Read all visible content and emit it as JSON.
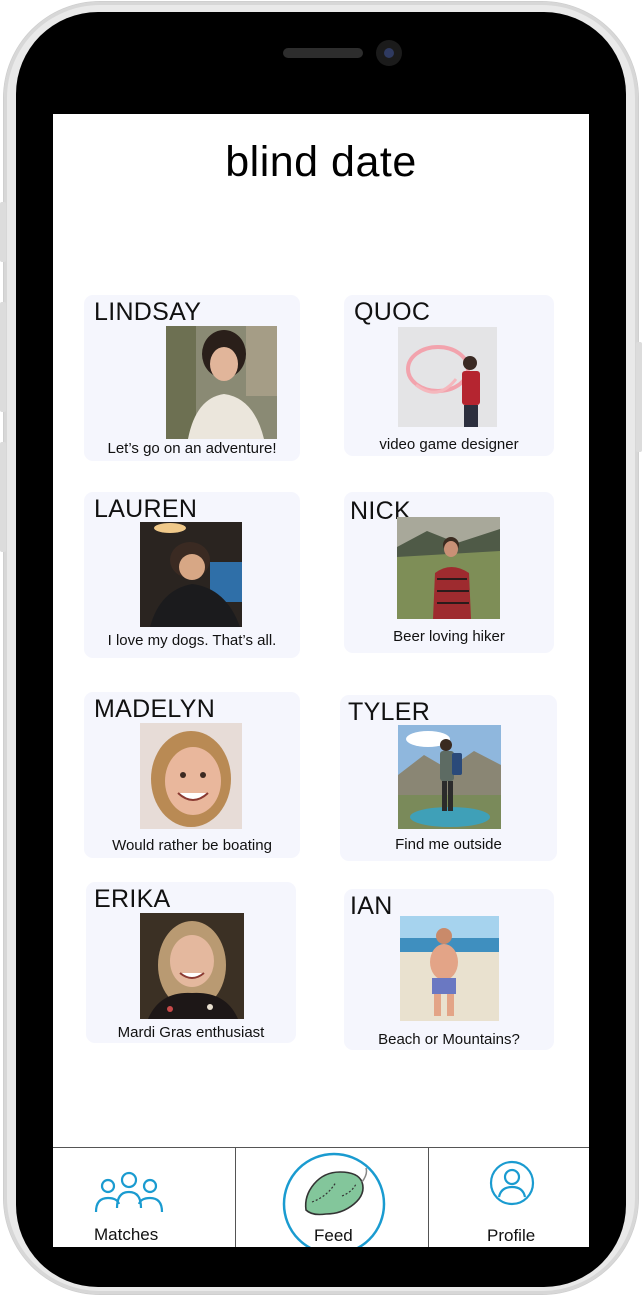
{
  "app": {
    "title": "blind date"
  },
  "profiles": [
    {
      "name": "LINDSAY",
      "tagline": "Let’s go on an adventure!",
      "photo": "woman with curly dark hair smiling outdoors"
    },
    {
      "name": "QUOC",
      "tagline": "video game designer",
      "photo": "man in red shirt posing by pink neon sign"
    },
    {
      "name": "LAUREN",
      "tagline": "I love my dogs. That’s all.",
      "photo": "woman leaning head indoors at night"
    },
    {
      "name": "NICK",
      "tagline": "Beer loving hiker",
      "photo": "man in plaid jacket on a grassy hill"
    },
    {
      "name": "MADELYN",
      "tagline": "Would rather be boating",
      "photo": "smiling woman with long blonde hair"
    },
    {
      "name": "TYLER",
      "tagline": "Find me outside",
      "photo": "hiker with backpack by a mountain lake"
    },
    {
      "name": "ERIKA",
      "tagline": "Mardi Gras enthusiast",
      "photo": "smiling woman with long hair"
    },
    {
      "name": "IAN",
      "tagline": "Beach or Mountains?",
      "photo": "man in swim trunks on a beach"
    }
  ],
  "nav": {
    "matches_label": "Matches",
    "feed_label": "Feed",
    "profile_label": "Profile",
    "matches_icon": "people-group-icon",
    "feed_icon": "sleep-mask-icon",
    "profile_icon": "user-circle-icon",
    "accent_color": "#1a9bd0"
  },
  "colors": {
    "card_background": "#f5f6fd",
    "screen_background": "#ffffff",
    "bezel": "#000000",
    "frame": "#e9e9e9",
    "mask_fill": "#83c69b"
  }
}
